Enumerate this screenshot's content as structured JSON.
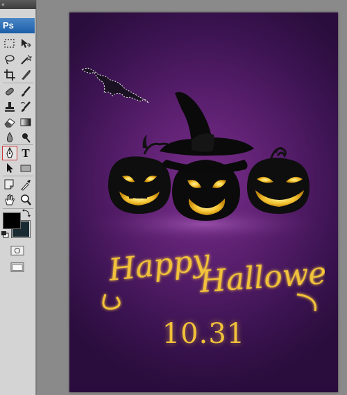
{
  "toolbox": {
    "grip_label": "«",
    "app_badge": "Ps",
    "tools": [
      {
        "name": "marquee-tool-icon"
      },
      {
        "name": "move-tool-icon"
      },
      {
        "name": "lasso-tool-icon"
      },
      {
        "name": "magic-wand-tool-icon"
      },
      {
        "name": "crop-tool-icon"
      },
      {
        "name": "eyedropper-slice-tool-icon"
      },
      {
        "name": "healing-brush-tool-icon"
      },
      {
        "name": "brush-tool-icon"
      },
      {
        "name": "clone-stamp-tool-icon"
      },
      {
        "name": "history-brush-tool-icon"
      },
      {
        "name": "eraser-tool-icon"
      },
      {
        "name": "gradient-tool-icon"
      },
      {
        "name": "blur-tool-icon"
      },
      {
        "name": "dodge-tool-icon"
      },
      {
        "name": "pen-tool-icon"
      },
      {
        "name": "type-tool-icon"
      },
      {
        "name": "path-selection-tool-icon"
      },
      {
        "name": "shape-tool-icon"
      },
      {
        "name": "notes-tool-icon"
      },
      {
        "name": "eyedropper-tool-icon"
      },
      {
        "name": "hand-tool-icon"
      },
      {
        "name": "zoom-tool-icon"
      }
    ],
    "type_tool_glyph": "T",
    "active_tool": "pen-tool-icon",
    "foreground_color": "#000000",
    "background_color": "#1a2a33"
  },
  "document": {
    "background_colors": [
      "#7a2e8c",
      "#2a0d3c"
    ],
    "greeting": {
      "line1": "Happy",
      "line2": "Halloween"
    },
    "date": "10.31",
    "text_color": "#f2c23a"
  }
}
